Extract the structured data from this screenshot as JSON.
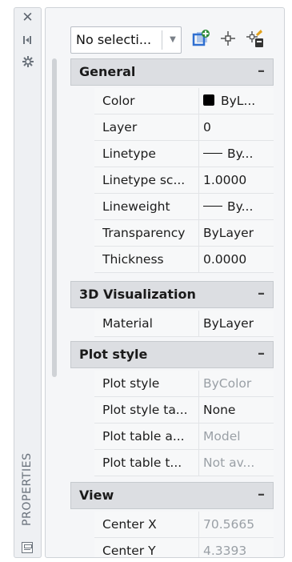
{
  "side_strip": {
    "title": "PROPERTIES",
    "icons": [
      "close-icon",
      "auto-hide-icon",
      "settings-icon",
      "properties-palette-icon"
    ]
  },
  "toolbar": {
    "selection_value": "No selecti...",
    "icons": [
      "toggle-pickadd-icon",
      "select-objects-icon",
      "quick-select-icon"
    ]
  },
  "sections": {
    "general": {
      "title": "General",
      "collapse": "–",
      "rows": [
        {
          "name": "Color",
          "value": "ByL..."
        },
        {
          "name": "Layer",
          "value": "0"
        },
        {
          "name": "Linetype",
          "value": "By..."
        },
        {
          "name": "Linetype sc...",
          "value": "1.0000"
        },
        {
          "name": "Lineweight",
          "value": "By..."
        },
        {
          "name": "Transparency",
          "value": "ByLayer"
        },
        {
          "name": "Thickness",
          "value": "0.0000"
        }
      ]
    },
    "visualization": {
      "title": "3D Visualization",
      "collapse": "–",
      "rows": [
        {
          "name": "Material",
          "value": "ByLayer"
        }
      ]
    },
    "plot_style": {
      "title": "Plot style",
      "collapse": "–",
      "rows": [
        {
          "name": "Plot style",
          "value": "ByColor"
        },
        {
          "name": "Plot style ta...",
          "value": "None"
        },
        {
          "name": "Plot table a...",
          "value": "Model"
        },
        {
          "name": "Plot table t...",
          "value": "Not av..."
        }
      ]
    },
    "view": {
      "title": "View",
      "collapse": "–",
      "rows": [
        {
          "name": "Center X",
          "value": "70.5665"
        },
        {
          "name": "Center Y",
          "value": "4.3393"
        }
      ]
    }
  },
  "colors": {
    "accent_green": "#2e8b3a",
    "accent_blue": "#2f6fd1",
    "section_bg": "#dcdee2",
    "dim_text": "#9aa0a6"
  }
}
